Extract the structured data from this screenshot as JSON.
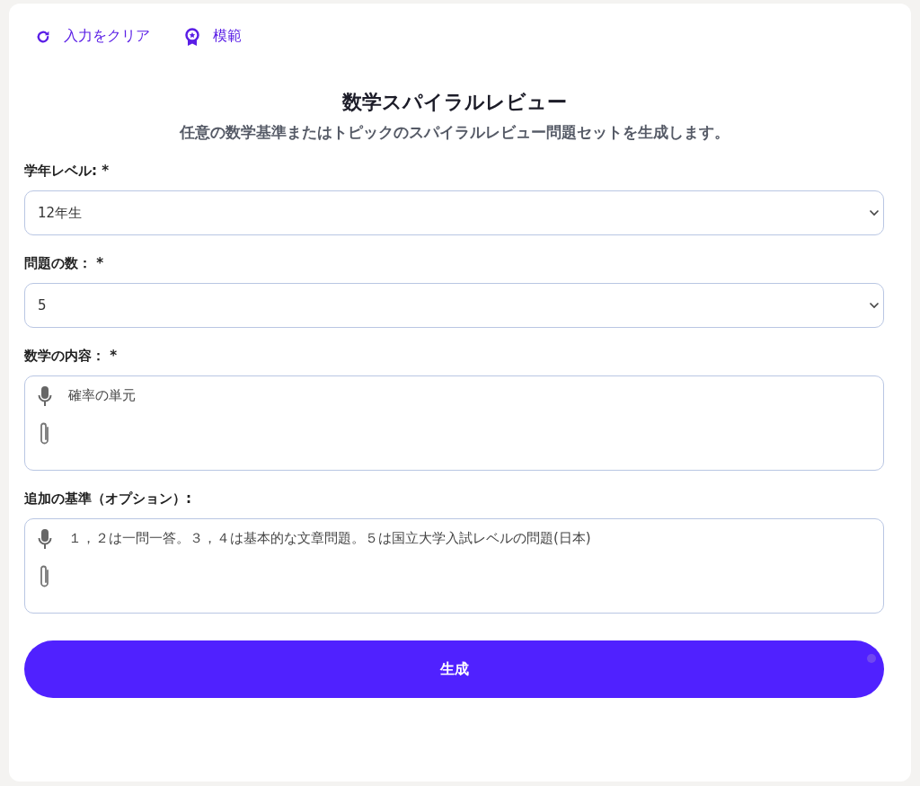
{
  "toolbar": [
    {
      "kind": "clear",
      "label": "入力をクリア"
    },
    {
      "kind": "example",
      "label": "模範"
    }
  ],
  "title": "数学スパイラルレビュー",
  "subtitle": "任意の数学基準またはトピックのスパイラルレビュー問題セットを生成します。",
  "fields": [
    {
      "kind": "select",
      "label": "学年レベル: *",
      "value": "12年生"
    },
    {
      "kind": "select",
      "label": "問題の数： *",
      "value": "5"
    },
    {
      "kind": "textarea",
      "label": "数学の内容： *",
      "value": "確率の単元"
    },
    {
      "kind": "textarea",
      "label": "追加の基準（オプション）:",
      "value": "１，２は一問一答。３，４は基本的な文章問題。５は国立大学入試レベルの問題(日本)"
    }
  ],
  "button": "生成"
}
